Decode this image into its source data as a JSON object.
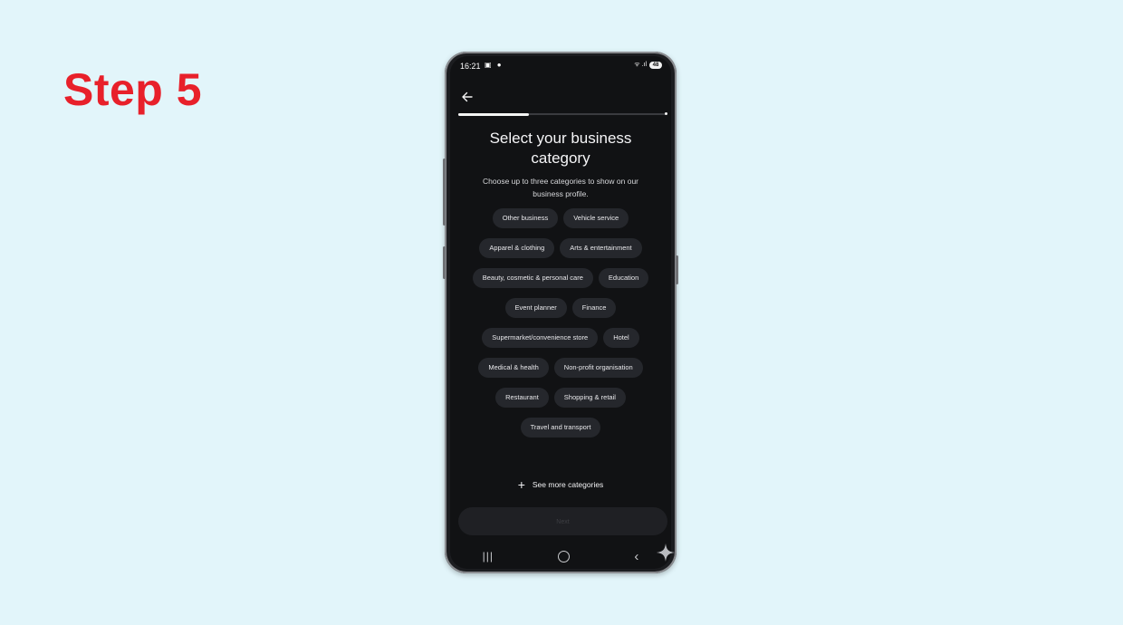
{
  "step": {
    "title": "Step 5"
  },
  "status_bar": {
    "time": "16:21",
    "left_icons": "▣ ●",
    "signal": "ᯤ .ıl",
    "battery": "48"
  },
  "header": {
    "back_icon": "arrow-left-icon",
    "progress_fraction": 0.34
  },
  "page": {
    "title": "Select your business category",
    "subtitle": "Choose up to three categories to show on our business profile."
  },
  "categories": [
    [
      "Other business",
      "Vehicle service"
    ],
    [
      "Apparel & clothing",
      "Arts & entertainment"
    ],
    [
      "Beauty, cosmetic & personal care",
      "Education"
    ],
    [
      "Event planner",
      "Finance"
    ],
    [
      "Supermarket/convenience store",
      "Hotel"
    ],
    [
      "Medical & health",
      "Non-profit organisation"
    ],
    [
      "Restaurant",
      "Shopping & retail"
    ],
    [
      "Travel and transport"
    ]
  ],
  "see_more": {
    "icon": "plus-icon",
    "label": "See more categories"
  },
  "next_button": {
    "label": "Next"
  },
  "nav": {
    "recent": "|||",
    "back": "‹"
  },
  "colors": {
    "step_title": "#e8202a",
    "background": "#e2f5fa",
    "screen": "#111214",
    "chip": "#25272c"
  }
}
